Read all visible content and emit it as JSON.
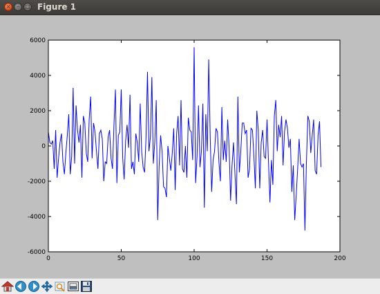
{
  "window": {
    "title": "Figure 1"
  },
  "toolbar": {
    "buttons": [
      {
        "icon": "home-icon"
      },
      {
        "icon": "back-icon"
      },
      {
        "icon": "forward-icon"
      },
      {
        "icon": "pan-icon"
      },
      {
        "icon": "zoom-icon"
      },
      {
        "icon": "configure-subplots-icon"
      },
      {
        "icon": "save-icon"
      }
    ]
  },
  "chart_data": {
    "type": "line",
    "title": "",
    "xlabel": "",
    "ylabel": "",
    "xlim": [
      0,
      200
    ],
    "ylim": [
      -6000,
      6000
    ],
    "xticks": [
      0,
      50,
      100,
      150,
      200
    ],
    "yticks": [
      -6000,
      -4000,
      -2000,
      0,
      2000,
      4000,
      6000
    ],
    "grid": false,
    "line_color": "#0000ff",
    "series": [
      {
        "values": [
          800,
          200,
          100,
          300,
          -1300,
          900,
          -1800,
          -700,
          200,
          700,
          -900,
          -1600,
          -400,
          600,
          1800,
          -1600,
          -600,
          3300,
          -1000,
          2300,
          900,
          200,
          1200,
          -1800,
          1700,
          1300,
          -400,
          -900,
          1500,
          2800,
          -700,
          1300,
          800,
          -300,
          -1300,
          700,
          900,
          400,
          -2000,
          -900,
          -1000,
          500,
          900,
          -700,
          -1300,
          1200,
          3200,
          -2100,
          600,
          800,
          3200,
          -700,
          -1900,
          300,
          1200,
          -100,
          2900,
          -1300,
          -900,
          -1600,
          700,
          200,
          -900,
          2400,
          -300,
          -1200,
          -1500,
          500,
          4200,
          -300,
          500,
          3900,
          -1000,
          200,
          2600,
          -4200,
          -1100,
          600,
          -300,
          -2300,
          -2400,
          -2900,
          0,
          -700,
          -1400,
          -400,
          1000,
          -2500,
          700,
          1700,
          -1100,
          2600,
          -1300,
          -1500,
          0,
          -1800,
          1600,
          900,
          800,
          -800,
          5600,
          -2100,
          -600,
          2300,
          -1200,
          -300,
          2400,
          -3500,
          1800,
          -300,
          4900,
          600,
          -2600,
          -800,
          -300,
          1000,
          800,
          -900,
          -2000,
          2200,
          -800,
          300,
          -900,
          1500,
          -100,
          -3100,
          -1100,
          200,
          -1600,
          -3300,
          2800,
          -1500,
          -300,
          1300,
          1300,
          700,
          900,
          -1800,
          -1300,
          1000,
          900,
          -600,
          -2400,
          2000,
          900,
          -2400,
          200,
          900,
          -600,
          -700,
          1500,
          -900,
          -3200,
          -800,
          -2200,
          1700,
          2600,
          -300,
          1200,
          500,
          1700,
          -1100,
          800,
          1500,
          1000,
          -100,
          400,
          -2600,
          -1100,
          -4200,
          -2800,
          -1300,
          400,
          -1000,
          -1200,
          -1000,
          -4800,
          -1000,
          1700,
          1400,
          -400,
          600,
          1500,
          -1400,
          -1600,
          600,
          1400,
          -1200
        ]
      }
    ]
  }
}
